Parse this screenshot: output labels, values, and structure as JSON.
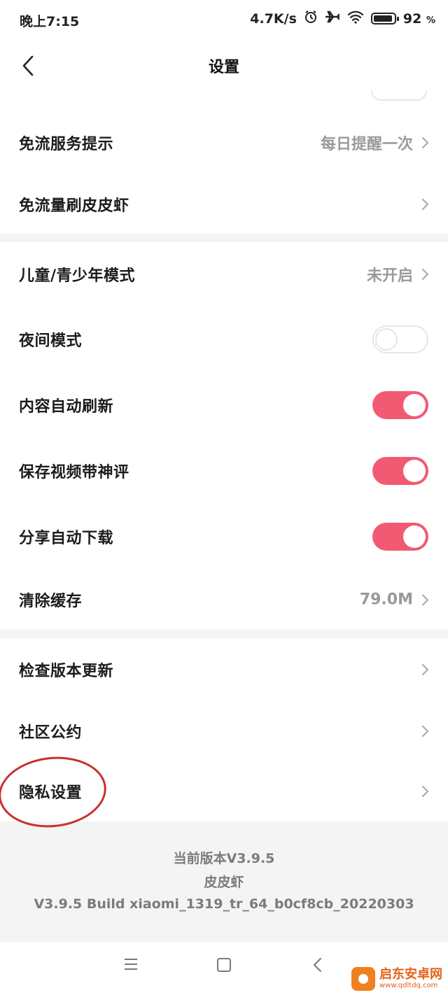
{
  "status_bar": {
    "time": "晚上7:15",
    "speed": "4.7K/s",
    "battery_percent": "92",
    "battery_suffix": "%",
    "battery_level": 0.92,
    "icons": [
      "alarm-icon",
      "airplane-icon",
      "wifi-icon",
      "battery-icon"
    ]
  },
  "header": {
    "title": "设置",
    "back_icon": "chevron-left-icon"
  },
  "sections": [
    {
      "items": [
        {
          "label": "免流服务提示",
          "value": "每日提醒一次",
          "type": "link"
        },
        {
          "label": "免流量刷皮皮虾",
          "value": "",
          "type": "link"
        }
      ]
    },
    {
      "items": [
        {
          "label": "儿童/青少年模式",
          "value": "未开启",
          "type": "link"
        },
        {
          "label": "夜间模式",
          "type": "toggle",
          "on": false
        },
        {
          "label": "内容自动刷新",
          "type": "toggle",
          "on": true
        },
        {
          "label": "保存视频带神评",
          "type": "toggle",
          "on": true
        },
        {
          "label": "分享自动下载",
          "type": "toggle",
          "on": true
        },
        {
          "label": "清除缓存",
          "value": "79.0M",
          "type": "link"
        }
      ]
    },
    {
      "items": [
        {
          "label": "检查版本更新",
          "value": "",
          "type": "link"
        },
        {
          "label": "社区公约",
          "value": "",
          "type": "link"
        },
        {
          "label": "隐私设置",
          "value": "",
          "type": "link"
        }
      ]
    }
  ],
  "footer": {
    "version": "当前版本V3.9.5",
    "app_name": "皮皮虾",
    "build": "V3.9.5 Build xiaomi_1319_tr_64_b0cf8cb_20220303"
  },
  "nav_keys": [
    "menu-icon",
    "home-square-icon",
    "back-triangle-icon"
  ],
  "watermark": {
    "name": "启东安卓网",
    "url": "www.qdltdq.com"
  },
  "colors": {
    "accent": "#f25a74",
    "annotation": "#c9302c"
  }
}
